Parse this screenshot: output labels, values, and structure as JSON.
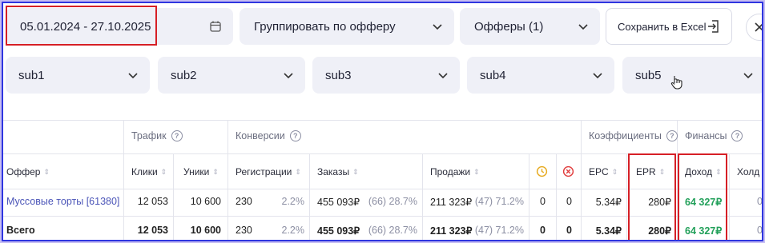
{
  "filters": {
    "date_range": "05.01.2024 - 27.10.2025",
    "group_by": "Группировать по офферу",
    "offers": "Офферы (1)",
    "export_label": "Сохранить в Excel"
  },
  "subs": [
    "sub1",
    "sub2",
    "sub3",
    "sub4",
    "sub5"
  ],
  "table": {
    "groups": {
      "traffic": "Трафик",
      "conversions": "Конверсии",
      "coefficients": "Коэффициенты",
      "finance": "Финансы"
    },
    "columns": {
      "offer": "Оффер",
      "clicks": "Клики",
      "uniques": "Уники",
      "registrations": "Регистрации",
      "orders": "Заказы",
      "sales": "Продажи",
      "epc": "EPC",
      "epr": "EPR",
      "income": "Доход",
      "hold": "Холд"
    },
    "rows": [
      {
        "offer": "Муссовые торты [61380]",
        "clicks": "12 053",
        "uniques": "10 600",
        "reg": "230",
        "reg_pct": "2.2%",
        "orders": "455 093₽",
        "orders_detail": "(66) 28.7%",
        "sales": "211 323₽",
        "sales_detail": "(47) 71.2%",
        "pending": "0",
        "rejected": "0",
        "epc": "5.34₽",
        "epr": "280₽",
        "income": "64 327₽",
        "hold": "0"
      },
      {
        "offer": "Всего",
        "clicks": "12 053",
        "uniques": "10 600",
        "reg": "230",
        "reg_pct": "2.2%",
        "orders": "455 093₽",
        "orders_detail": "(66) 28.7%",
        "sales": "211 323₽",
        "sales_detail": "(47) 71.2%",
        "pending": "0",
        "rejected": "0",
        "epc": "5.34₽",
        "epr": "280₽",
        "income": "64 327₽",
        "hold": "0"
      }
    ]
  },
  "colors": {
    "highlight": "#d61f26",
    "income": "#22a05a",
    "link": "#4b55b8",
    "border": "#2f36e0"
  }
}
